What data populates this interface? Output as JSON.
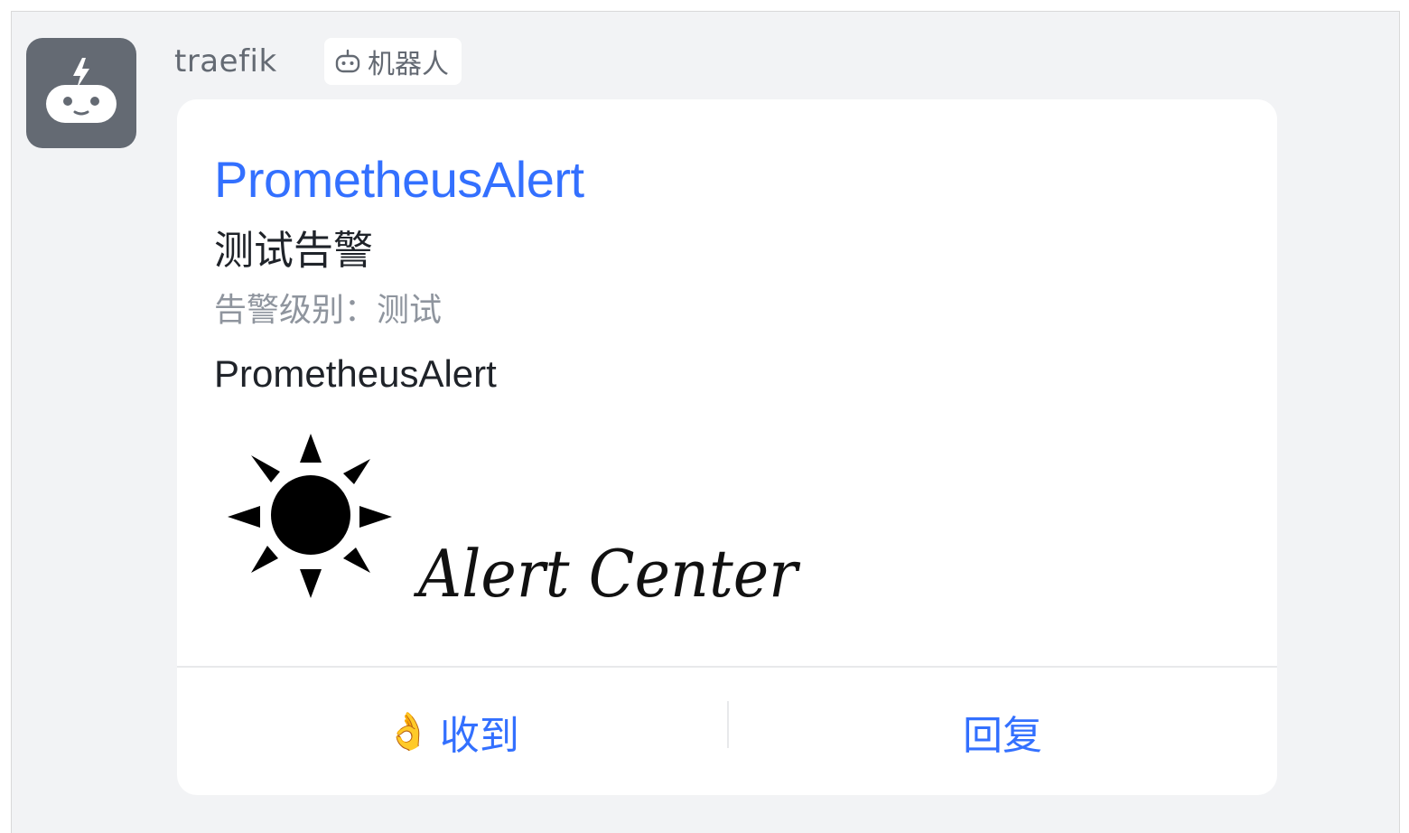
{
  "message": {
    "sender": "traefik",
    "sender_tag": "机器人",
    "avatar_icon": "robot-icon",
    "tag_icon": "robot-icon"
  },
  "card": {
    "title": "PrometheusAlert",
    "heading": "测试告警",
    "level_line": "告警级别：测试",
    "body": "PrometheusAlert",
    "image": {
      "description_icon": "sun-logo-icon",
      "logo_text": "Alert Center"
    },
    "actions": [
      {
        "icon": "👌",
        "label": "收到"
      },
      {
        "label": "回复"
      }
    ]
  },
  "colors": {
    "link_blue": "#3370ff",
    "background": "#f2f3f5",
    "avatar_bg": "#646a73",
    "muted_text": "#8f959e"
  }
}
